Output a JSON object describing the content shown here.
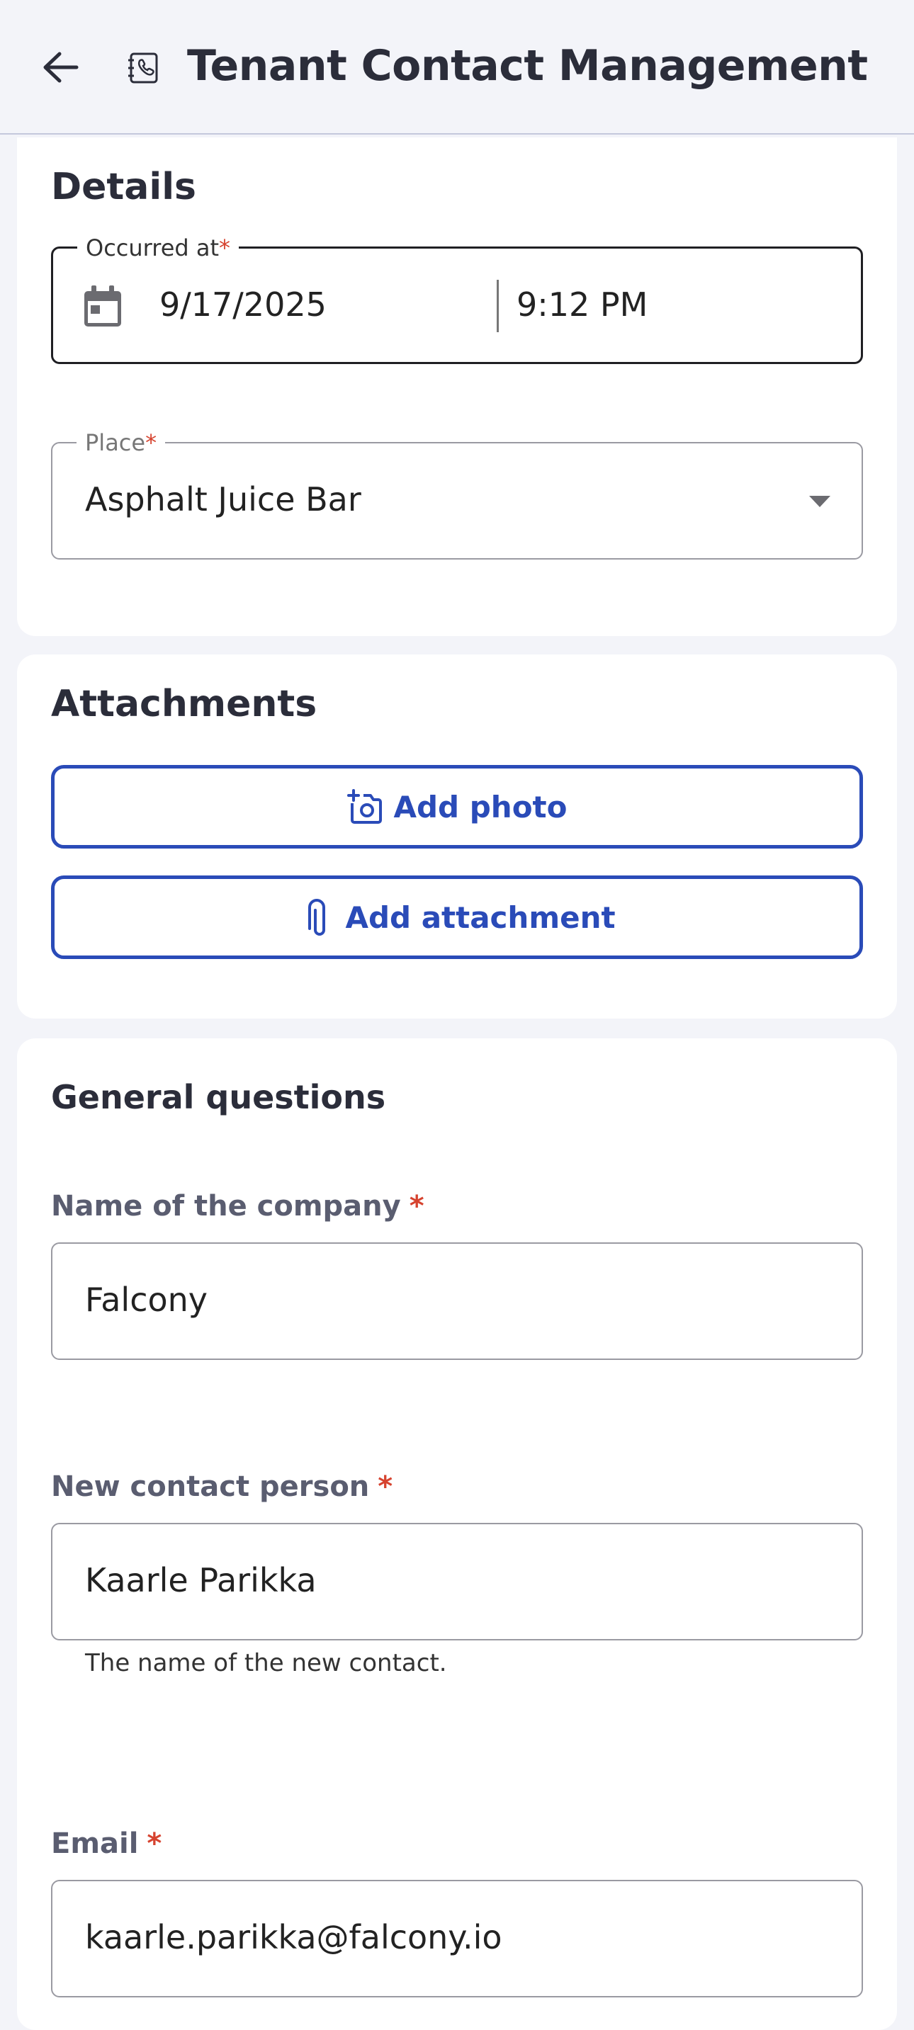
{
  "appbar": {
    "title": "Tenant Contact Management",
    "back_icon": "arrow-left-icon",
    "app_icon": "contact-book-icon"
  },
  "details": {
    "title": "Details",
    "occurred_at": {
      "label": "Occurred at",
      "required_mark": "*",
      "date": "9/17/2025",
      "time": "9:12 PM",
      "icon": "calendar-icon"
    },
    "place": {
      "label": "Place",
      "required_mark": "*",
      "value": "Asphalt Juice Bar",
      "icon": "dropdown-arrow-icon"
    }
  },
  "attachments": {
    "title": "Attachments",
    "add_photo_label": "Add photo",
    "add_attachment_label": "Add attachment"
  },
  "general": {
    "heading": "General questions",
    "company": {
      "label": "Name of the company",
      "required_mark": "*",
      "value": "Falcony"
    },
    "contact_person": {
      "label": "New contact person",
      "required_mark": "*",
      "value": "Kaarle Parikka",
      "helper": "The name of the new contact."
    },
    "email": {
      "label": "Email",
      "required_mark": "*",
      "value": "kaarle.parikka@falcony.io"
    }
  },
  "colors": {
    "accent": "#2a4bb8",
    "required": "#d6432f",
    "background": "#f3f4f9"
  }
}
